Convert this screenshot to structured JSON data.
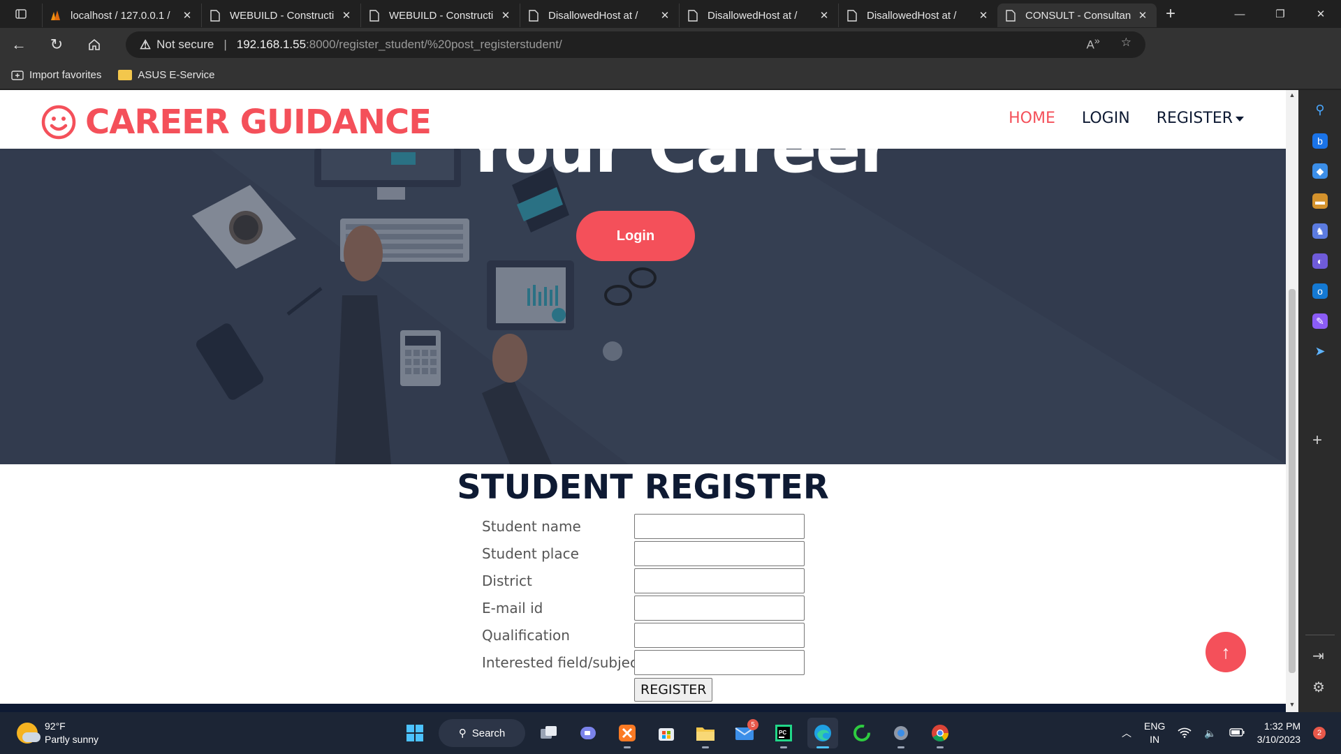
{
  "browser": {
    "tabs": [
      {
        "title": "localhost / 127.0.0.1 / ",
        "icon": "phpmyadmin-icon",
        "active": false
      },
      {
        "title": "WEBUILD - Constructi",
        "icon": "page-icon",
        "active": false
      },
      {
        "title": "WEBUILD - Constructi",
        "icon": "page-icon",
        "active": false
      },
      {
        "title": "DisallowedHost at /",
        "icon": "page-icon",
        "active": false
      },
      {
        "title": "DisallowedHost at /",
        "icon": "page-icon",
        "active": false
      },
      {
        "title": "DisallowedHost at /",
        "icon": "page-icon",
        "active": false
      },
      {
        "title": "CONSULT - Consultan",
        "icon": "page-icon",
        "active": true
      }
    ],
    "security_label": "Not secure",
    "url_host": "192.168.1.55",
    "url_path": ":8000/register_student/%20post_registerstudent/",
    "favorites": [
      {
        "label": "Import favorites",
        "icon": "import-icon"
      },
      {
        "label": "ASUS E-Service",
        "icon": "folder-icon"
      }
    ]
  },
  "site": {
    "brand": "CAREER GUIDANCE",
    "brand_color": "#f4505a",
    "nav": {
      "home": "HOME",
      "login": "LOGIN",
      "register": "REGISTER"
    },
    "hero": {
      "heading": "Your Career",
      "button": "Login"
    },
    "form": {
      "title": "STUDENT REGISTER",
      "fields": [
        {
          "label": "Student name",
          "value": ""
        },
        {
          "label": "Student place",
          "value": ""
        },
        {
          "label": "District",
          "value": ""
        },
        {
          "label": "E-mail id",
          "value": ""
        },
        {
          "label": "Qualification",
          "value": ""
        },
        {
          "label": "Interested field/subject",
          "value": ""
        }
      ],
      "submit": "REGISTER"
    }
  },
  "taskbar": {
    "weather_temp": "92°F",
    "weather_desc": "Partly sunny",
    "search_label": "Search",
    "mail_badge": "5",
    "lang_top": "ENG",
    "lang_bottom": "IN",
    "time": "1:32 PM",
    "date": "3/10/2023",
    "notifications": "2"
  }
}
